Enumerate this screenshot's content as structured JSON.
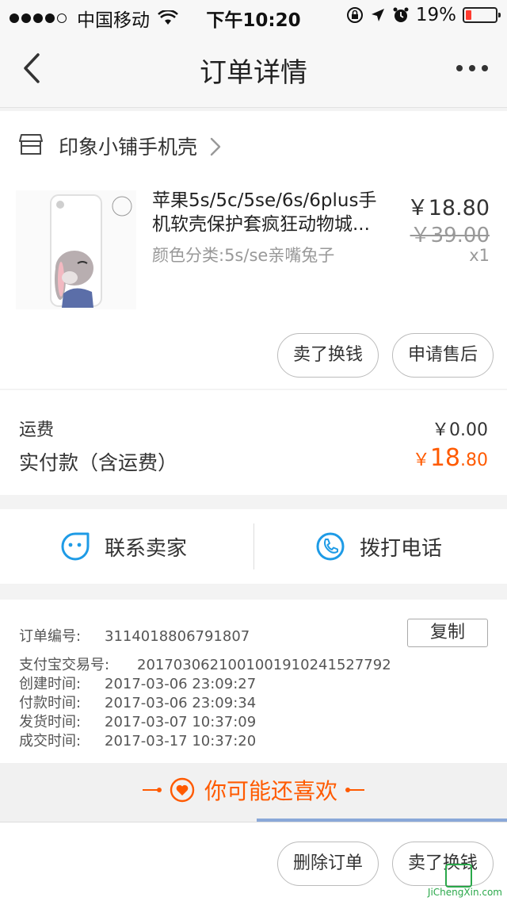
{
  "status_bar": {
    "carrier": "中国移动",
    "time": "下午10:20",
    "battery": "19%",
    "battery_level": 0.19,
    "battery_color": "#ff3b30"
  },
  "nav": {
    "title": "订单详情",
    "back_icon": "chevron-left-icon",
    "more_icon": "more-dots-icon"
  },
  "store": {
    "name": "印象小铺手机壳",
    "icon": "store-icon"
  },
  "product": {
    "name": "苹果5s/5c/5se/6s/6plus手机软壳保护套疯狂动物城...",
    "spec": "颜色分类:5s/se亲嘴兔子",
    "price": "￥18.80",
    "original_price": "￥39.00",
    "quantity": "x1",
    "buttons": {
      "sell": "卖了换钱",
      "after_sales": "申请售后"
    }
  },
  "totals": {
    "shipping_label": "运费",
    "shipping_value": "￥0.00",
    "paid_label": "实付款（含运费）",
    "paid_currency": "￥",
    "paid_integer": "18",
    "paid_decimal": ".80",
    "accent_color": "#ff5a00"
  },
  "contact": {
    "seller": "联系卖家",
    "phone": "拨打电话",
    "accent_color": "#1e9be6"
  },
  "order_info": {
    "copy_button": "复制",
    "rows": [
      {
        "label": "订单编号:",
        "value": "3114018806791807"
      },
      {
        "label": "支付宝交易号:",
        "value": "2017030621001001910241527792"
      },
      {
        "label": "创建时间:",
        "value": "2017-03-06 23:09:27"
      },
      {
        "label": "付款时间:",
        "value": "2017-03-06 23:09:34"
      },
      {
        "label": "发货时间:",
        "value": "2017-03-07 10:37:09"
      },
      {
        "label": "成交时间:",
        "value": "2017-03-17 10:37:20"
      }
    ]
  },
  "recommend": {
    "title": "你可能还喜欢",
    "icon": "heart-icon"
  },
  "bottom_bar": {
    "delete": "删除订单",
    "sell": "卖了换钱"
  },
  "watermark": {
    "text": "JiChengXin.com"
  }
}
